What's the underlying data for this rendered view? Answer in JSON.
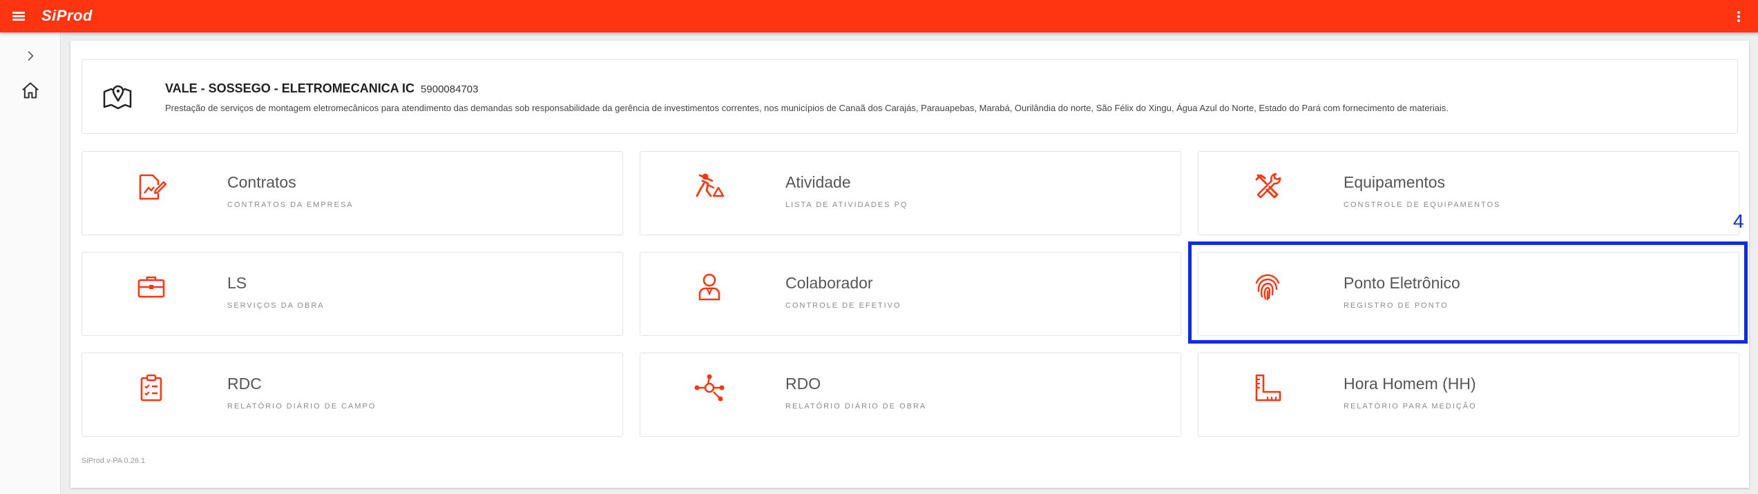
{
  "app": {
    "brand": "SiProd",
    "version": "SiProd v-PA 0.26.1",
    "accent_color": "#ff3512",
    "icons": {
      "menu": "hamburger-icon",
      "more": "kebab-vertical-icon"
    }
  },
  "sidenav": {
    "items": [
      {
        "label": "Expandir",
        "icon": "chevron-right-icon"
      },
      {
        "label": "Início",
        "icon": "home-icon"
      }
    ]
  },
  "project": {
    "name": "VALE - SOSSEGO - ELETROMECANICA IC",
    "code": "5900084703",
    "description": "Prestação de serviços de montagem eletromecânicos para atendimento das demandas sob responsabilidade da gerência de investimentos correntes, nos municípios de Canaã dos Carajás, Parauapebas, Marabá, Ourilândia do norte, São Félix do Xingu, Água Azul do Norte, Estado do Pará com fornecimento de materiais.",
    "icon": "map-pin-icon"
  },
  "cards": [
    {
      "title": "Contratos",
      "subtitle": "CONTRATOS DA EMPRESA",
      "icon": "document-edit-icon"
    },
    {
      "title": "Atividade",
      "subtitle": "LISTA DE ATIVIDADES PQ",
      "icon": "worker-digging-icon"
    },
    {
      "title": "Equipamentos",
      "subtitle": "CONSTROLE DE EQUIPAMENTOS",
      "icon": "tools-icon"
    },
    {
      "title": "LS",
      "subtitle": "SERVIÇOS DA OBRA",
      "icon": "briefcase-icon"
    },
    {
      "title": "Colaborador",
      "subtitle": "CONTROLE DE EFETIVO",
      "icon": "user-icon"
    },
    {
      "title": "Ponto Eletrônico",
      "subtitle": "REGISTRO DE PONTO",
      "icon": "fingerprint-icon"
    },
    {
      "title": "RDC",
      "subtitle": "RELATÓRIO DIÁRIO DE CAMPO",
      "icon": "clipboard-checklist-icon"
    },
    {
      "title": "RDO",
      "subtitle": "RELATÓRIO DIÁRIO DE OBRA",
      "icon": "network-nodes-icon"
    },
    {
      "title": "Hora Homem (HH)",
      "subtitle": "RELATÓRIO PARA MEDIÇÃO",
      "icon": "ruler-square-icon"
    }
  ],
  "annotation": {
    "label": "4",
    "color": "#0a2cf0"
  }
}
